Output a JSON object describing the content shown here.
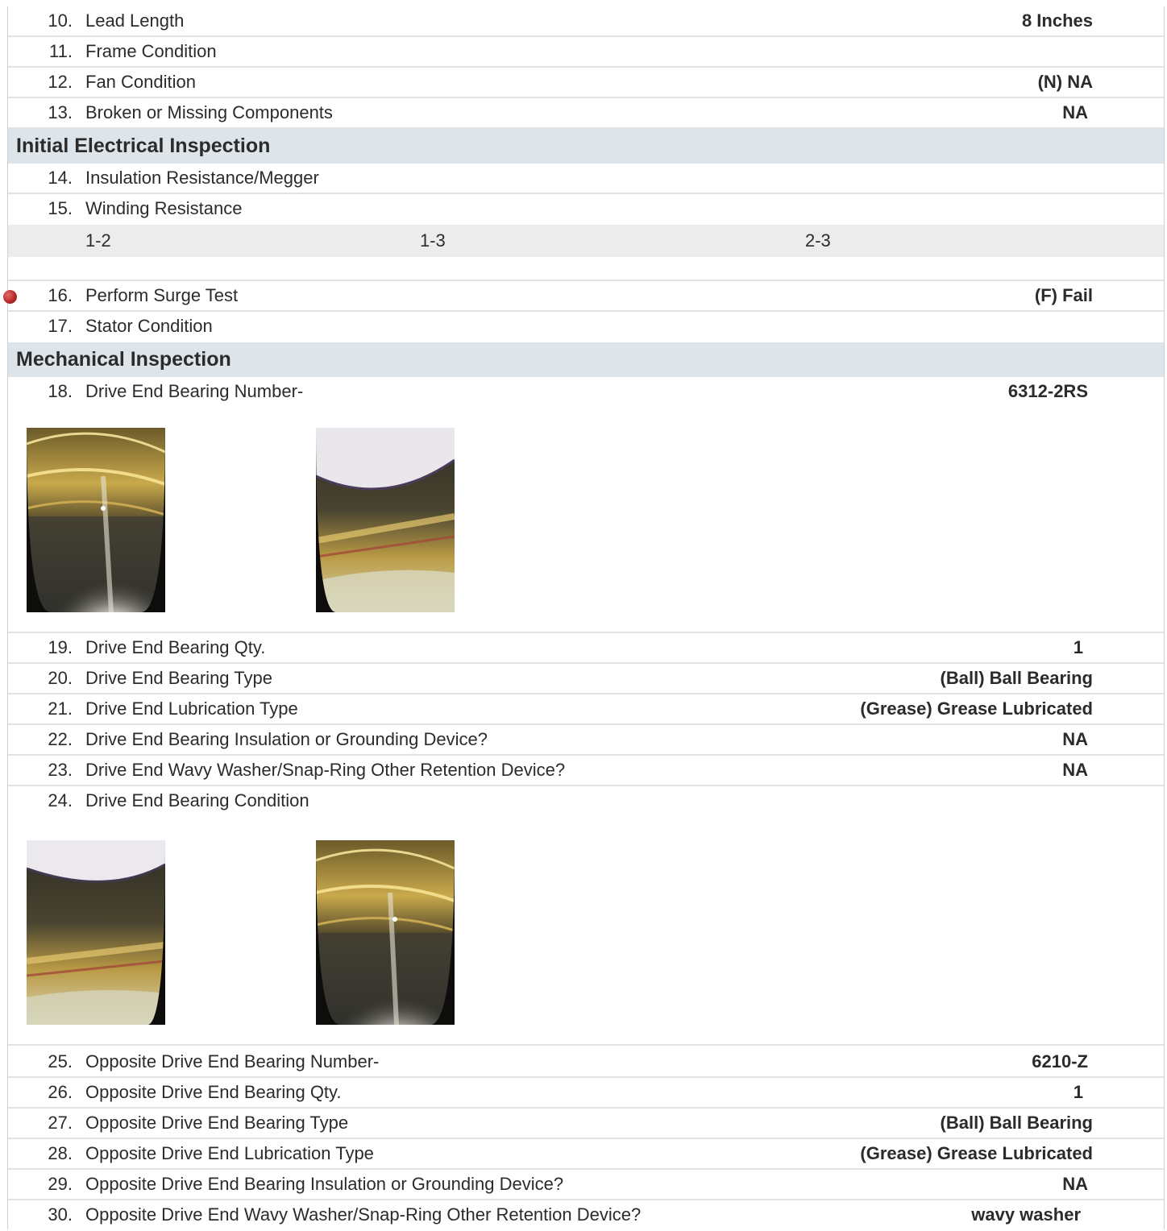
{
  "items_top": [
    {
      "num": "10.",
      "label": "Lead Length",
      "value": "8 Inches"
    },
    {
      "num": "11.",
      "label": "Frame Condition",
      "value": ""
    },
    {
      "num": "12.",
      "label": "Fan Condition",
      "value": "(N) NA"
    },
    {
      "num": "13.",
      "label": "Broken or Missing Components",
      "value": "NA"
    }
  ],
  "section_electrical": "Initial Electrical Inspection",
  "items_electrical": [
    {
      "num": "14.",
      "label": "Insulation Resistance/Megger",
      "value": ""
    },
    {
      "num": "15.",
      "label": "Winding Resistance",
      "value": ""
    }
  ],
  "winding_columns": [
    "1-2",
    "1-3",
    "2-3"
  ],
  "surge": {
    "num": "16.",
    "label": "Perform Surge Test",
    "value": "(F) Fail",
    "flag_color": "#b82a2a"
  },
  "stator": {
    "num": "17.",
    "label": "Stator Condition",
    "value": ""
  },
  "section_mechanical": "Mechanical Inspection",
  "item_18": {
    "num": "18.",
    "label": "Drive End Bearing Number-",
    "value": "6312-2RS"
  },
  "items_drive_end": [
    {
      "num": "19.",
      "label": "Drive End Bearing Qty.",
      "value": "1"
    },
    {
      "num": "20.",
      "label": "Drive End Bearing Type",
      "value": "(Ball) Ball Bearing"
    },
    {
      "num": "21.",
      "label": "Drive End Lubrication Type",
      "value": "(Grease) Grease Lubricated"
    },
    {
      "num": "22.",
      "label": "Drive End Bearing Insulation or Grounding Device?",
      "value": "NA"
    },
    {
      "num": "23.",
      "label": "Drive End Wavy Washer/Snap-Ring Other Retention Device?",
      "value": "NA"
    },
    {
      "num": "24.",
      "label": "Drive End Bearing Condition",
      "value": ""
    }
  ],
  "items_opposite_end": [
    {
      "num": "25.",
      "label": "Opposite Drive End Bearing Number-",
      "value": "6210-Z"
    },
    {
      "num": "26.",
      "label": "Opposite Drive End Bearing Qty.",
      "value": "1"
    },
    {
      "num": "27.",
      "label": "Opposite Drive End Bearing Type",
      "value": "(Ball) Ball Bearing"
    },
    {
      "num": "28.",
      "label": "Opposite Drive End Lubrication Type",
      "value": "(Grease) Grease Lubricated"
    },
    {
      "num": "29.",
      "label": "Opposite Drive End Bearing Insulation or Grounding Device?",
      "value": "NA"
    },
    {
      "num": "30.",
      "label": "Opposite Drive End Wavy Washer/Snap-Ring Other Retention Device?",
      "value": "wavy washer"
    }
  ]
}
